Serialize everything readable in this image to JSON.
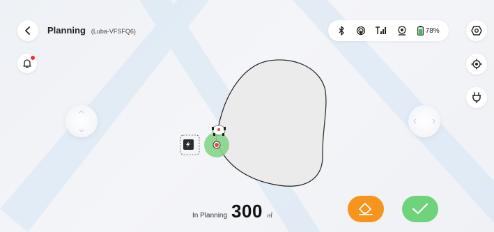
{
  "header": {
    "title": "Planning",
    "subtitle": "(Luba-VFSFQ6)"
  },
  "status_bar": {
    "icons": [
      "bluetooth-icon",
      "wifi-icon",
      "cellular-signal-icon",
      "gnss-icon",
      "battery-icon"
    ],
    "battery_text": "78%",
    "battery_level": 0.78,
    "battery_color": "#3cbd5b"
  },
  "side_buttons": [
    "settings-hexagon-icon",
    "locate-target-icon",
    "charging-plug-icon"
  ],
  "notification": {
    "has_unread": true,
    "dot_color": "#e6353a"
  },
  "footer": {
    "label": "In Planning",
    "value": "300",
    "unit": "㎡"
  },
  "actions": {
    "erase": {
      "icon": "eraser-icon",
      "color": "#f7941d"
    },
    "confirm": {
      "icon": "checkmark-icon",
      "color": "#6fd37c"
    }
  },
  "colors": {
    "boundary": "#222222",
    "area_fill": "#ebebeb",
    "mower_zone": "#86d58a",
    "mower_marker": "#e34b3a"
  }
}
